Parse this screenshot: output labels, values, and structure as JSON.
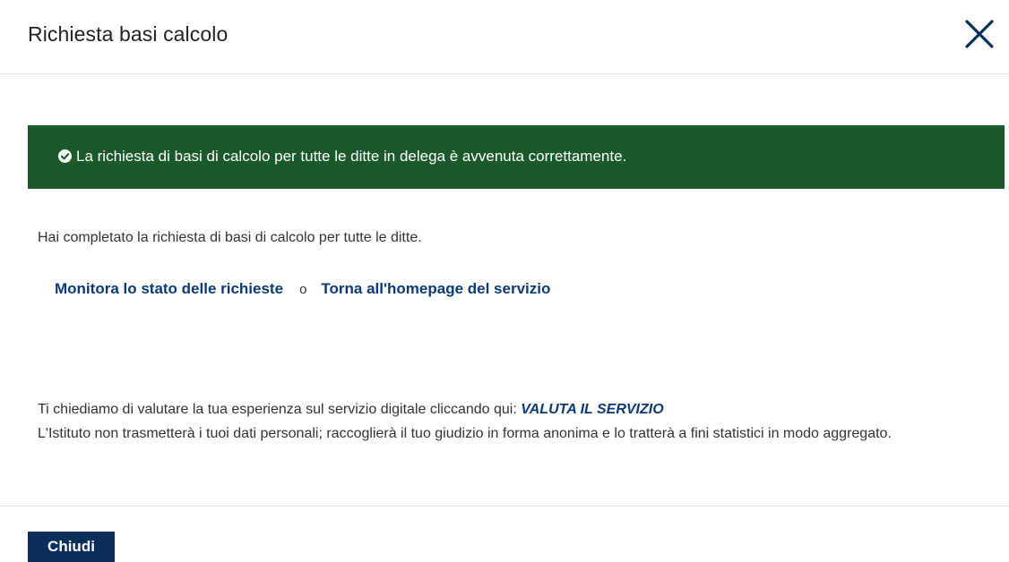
{
  "modal": {
    "title": "Richiesta basi calcolo",
    "close_icon": "close-icon"
  },
  "alert": {
    "icon": "check-circle-icon",
    "message": "La richiesta di basi di calcolo per tutte le ditte in delega è avvenuta correttamente.",
    "background_color": "#1a5a2a"
  },
  "body": {
    "completion_text": "Hai completato la richiesta di basi di calcolo per tutte le ditte.",
    "link_monitor": "Monitora lo stato delle richieste",
    "separator": "o",
    "link_homepage": "Torna all'homepage del servizio"
  },
  "feedback": {
    "prompt": "Ti chiediamo di valutare la tua esperienza sul servizio digitale cliccando qui:",
    "link_label": "VALUTA IL SERVIZIO",
    "privacy_note": "L'Istituto non trasmetterà i tuoi dati personali; raccoglierà il tuo giudizio in forma anonima e lo tratterà a fini statistici in modo aggregato."
  },
  "footer": {
    "close_button_label": "Chiudi"
  },
  "colors": {
    "link": "#0b3b72",
    "primary_button": "#0b2f5a"
  }
}
